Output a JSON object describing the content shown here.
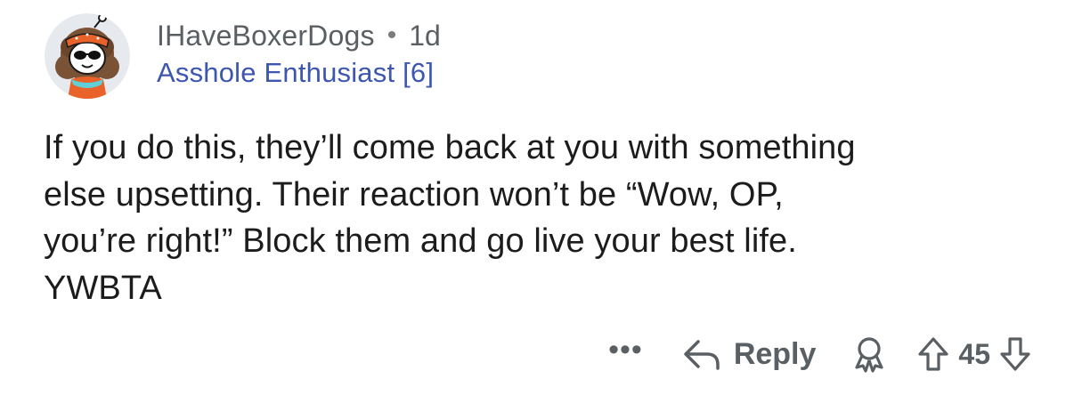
{
  "comment": {
    "author": "IHaveBoxerDogs",
    "separator": "•",
    "age": "1d",
    "flair": "Asshole Enthusiast [6]",
    "body": "If you do this, they’ll come back at you with something\nelse upsetting. Their reaction won’t be “Wow, OP,\nyou’re right!” Block them and go live your best life.\nYWBTA"
  },
  "actions": {
    "more_label": "•••",
    "reply_label": "Reply",
    "score": "45"
  },
  "icons": {
    "avatar": "snoo-avatar-icon",
    "reply": "reply-arrow-icon",
    "award": "award-icon",
    "upvote": "upvote-arrow-icon",
    "downvote": "downvote-arrow-icon"
  },
  "colors": {
    "username": "#5a5f63",
    "flair": "#3d56b2",
    "body": "#1c1c1c",
    "action": "#5a5f63"
  }
}
